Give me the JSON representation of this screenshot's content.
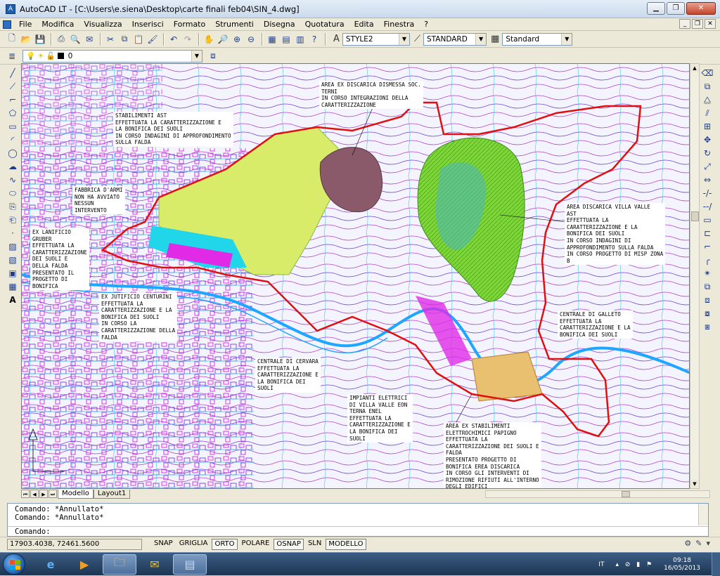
{
  "window": {
    "title": "AutoCAD LT - [C:\\Users\\e.siena\\Desktop\\carte finali feb04\\SIN_4.dwg]"
  },
  "menu": [
    "File",
    "Modifica",
    "Visualizza",
    "Inserisci",
    "Formato",
    "Strumenti",
    "Disegna",
    "Quotatura",
    "Edita",
    "Finestra",
    "?"
  ],
  "toolbar": {
    "text_style": "STYLE2",
    "dim_style": "STANDARD",
    "table_style": "Standard",
    "layer": "0"
  },
  "notes": [
    {
      "id": "ast",
      "text": "STABILIMENTI AST\nEFFETTUATA LA CARATTERIZZAZIONE E\nLA BONIFICA DEI SUOLI\nIN CORSO INDAGINI DI APPROFONDIMENTO\nSULLA FALDA"
    },
    {
      "id": "discarica-terni",
      "text": "AREA EX DISCARICA DISMESSA SOC.\nTERNI\nIN CORSO INTEGRAZIONI DELLA\nCARATTERIZZAZIONE"
    },
    {
      "id": "fabbrica-armi",
      "text": "FABBRICA D'ARMI\nNON HA AVVIATO\nNESSUN\nINTERVENTO"
    },
    {
      "id": "lanificio",
      "text": "EX LANIFICIO\nGRUBER\nEFFETTUATA LA\nCARATTERIZZAZIONE\nDEI SUOLI E\nDELLA FALDA\nPRESENTATO IL\nPROGETTO DI\nBONIFICA"
    },
    {
      "id": "villa-valle",
      "text": "AREA DISCARICA VILLA VALLE\nAST\nEFFETTUATA LA\nCARATTERIZZAZIONE E LA\nBONIFICA DEI SUOLI\nIN CORSO INDAGINI DI\nAPPROFONDIMENTO SULLA FALDA\nIN CORSO PROGETTO DI MISP ZONA\nB"
    },
    {
      "id": "centurini",
      "text": "EX JUTIFICIO CENTURINI\nEFFETTUATA LA\nCARATTERIZZAZIONE E LA\nBONIFICA DEI SUOLI\nIN CORSO LA\nCARATTERIZZAZIONE DELLA\nFALDA"
    },
    {
      "id": "galleto",
      "text": "CENTRALE DI GALLETO\nEFFETTUATA LA\nCARATTERIZZAZIONE E LA\nBONIFICA DEI SUOLI"
    },
    {
      "id": "cervara",
      "text": "CENTRALE DI CERVARA\nEFFETTUATA LA\nCARATTERIZZAZIONE E\nLA BONIFICA DEI\nSUOLI"
    },
    {
      "id": "impianti-enel",
      "text": "IMPIANTI ELETTRICI\nDI VILLA VALLE EON\nTERNA ENEL\nEFFETTUATA LA\nCARATTERIZZAZIONE E\nLA BONIFICA DEI\nSUOLI"
    },
    {
      "id": "papigno",
      "text": "AREA EX STABILIMENTI\nELETTROCHIMICI PAPIGNO\nEFFETTUATA LA\nCARATTERIZZAZIONE DEI SUOLI E\nFALDA\nPRESENTATO PROGETTO DI\nBONIFICA EREA DISCARICA\nIN CORSO GLI INTERVENTI DI\nRIMOZIONE RIFIUTI ALL'INTERNO\nDEGLI EDIFICI"
    }
  ],
  "tabs": [
    "Modello",
    "Layout1"
  ],
  "command": {
    "history": [
      "Comando: *Annullato*",
      "Comando: *Annullato*"
    ],
    "prompt": "Comando:"
  },
  "status": {
    "coords": "17903.4038, 72461.5600",
    "modes": [
      {
        "label": "SNAP",
        "on": false
      },
      {
        "label": "GRIGLIA",
        "on": false
      },
      {
        "label": "ORTO",
        "on": true
      },
      {
        "label": "POLARE",
        "on": false
      },
      {
        "label": "OSNAP",
        "on": true
      },
      {
        "label": "SLN",
        "on": false
      },
      {
        "label": "MODELLO",
        "on": true
      }
    ]
  },
  "taskbar": {
    "language": "IT",
    "time": "09:18",
    "date": "16/05/2013"
  },
  "colors": {
    "boundary": "#e01010",
    "ast_zone": "#d8ec6a",
    "cyan": "#21d6e8",
    "magenta": "#e02ae6",
    "green_zone": "#7ed63a",
    "brown_zone": "#8a5a6a"
  }
}
